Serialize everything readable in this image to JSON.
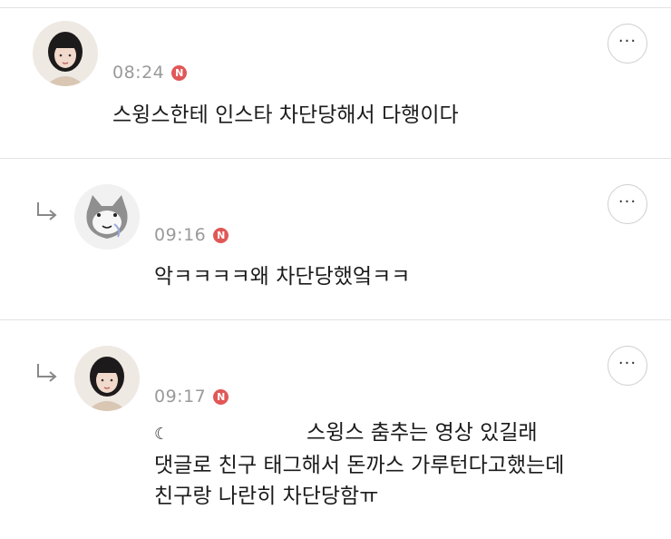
{
  "comments": [
    {
      "time": "08:24",
      "badge": "N",
      "text": "스윙스한테 인스타 차단당해서 다행이다",
      "more_label": "···"
    },
    {
      "time": "09:16",
      "badge": "N",
      "text": "악ㅋㅋㅋㅋ왜 차단당했엌ㅋㅋ",
      "more_label": "···"
    },
    {
      "time": "09:17",
      "badge": "N",
      "emoji": "☾",
      "lines": [
        "스윙스 춤추는 영상 있길래",
        "댓글로 친구 태그해서 돈까스 가루턴다고했는데",
        "친구랑 나란히 차단당함ㅠ"
      ],
      "more_label": "···"
    }
  ],
  "colors": {
    "badge": "#e15757",
    "time": "#9a9a9a",
    "divider": "#e3e3e3"
  }
}
